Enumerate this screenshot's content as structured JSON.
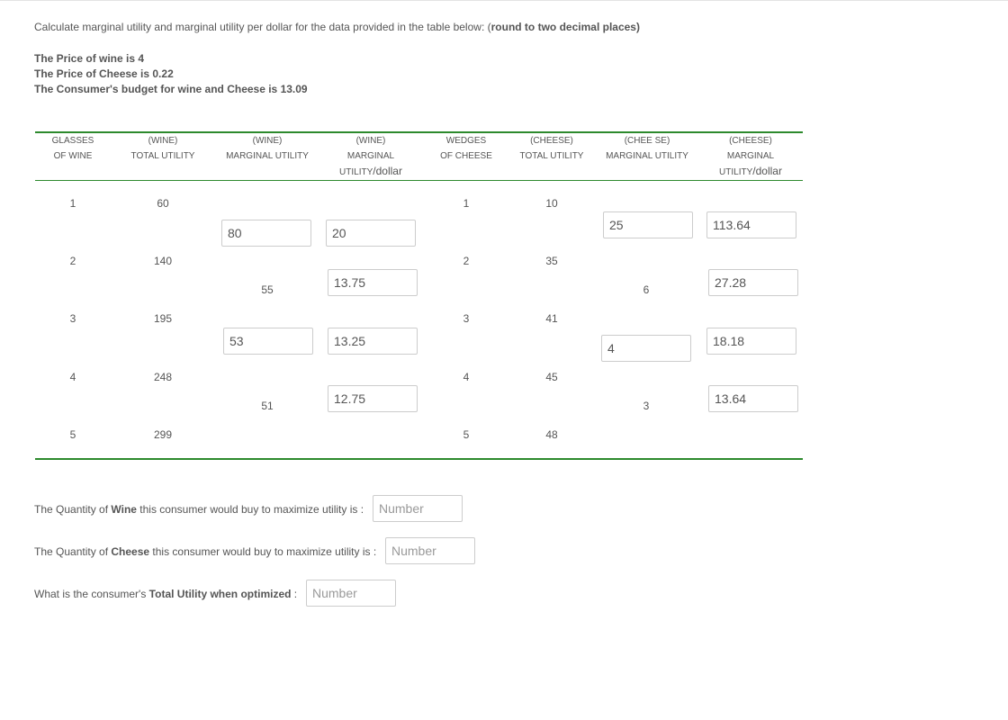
{
  "instructions": {
    "prefix": "Calculate marginal utility and marginal utility per dollar for the data provided in the table below: (",
    "bold": "round to two decimal places",
    "suffix": ")"
  },
  "given": {
    "wine_price": "The Price of wine is 4",
    "cheese_price": "The Price of Cheese is 0.22",
    "budget": "The Consumer's budget for wine and Cheese is 13.09"
  },
  "headers": {
    "glasses": [
      "GLASSES",
      "OF WINE"
    ],
    "wine_tu": [
      "(WINE)",
      "TOTAL UTILITY"
    ],
    "wine_mu": [
      "(WINE)",
      "MARGINAL UTILITY"
    ],
    "wine_mupd": [
      "(WINE)",
      "MARGINAL",
      "UTILITY",
      "/dollar"
    ],
    "wedges": [
      "WEDGES",
      "OF CHEESE"
    ],
    "cheese_tu": [
      "(CHEESE)",
      "TOTAL UTILITY"
    ],
    "cheese_mu": [
      "(CHEE SE)",
      "MARGINAL UTILITY"
    ],
    "cheese_mupd": [
      "(CHEESE)",
      "MARGINAL",
      "UTILITY",
      "/dollar"
    ]
  },
  "table": {
    "glasses": [
      "1",
      "2",
      "3",
      "4",
      "5"
    ],
    "wine_total_utility": [
      "60",
      "140",
      "195",
      "248",
      "299"
    ],
    "wedges": [
      "1",
      "2",
      "3",
      "4",
      "5"
    ],
    "cheese_total_utility": [
      "10",
      "35",
      "41",
      "45",
      "48"
    ],
    "wine_marginal_utility": [
      "80",
      "55",
      "53",
      "51"
    ],
    "wine_mu_per_dollar": [
      "20",
      "13.75",
      "13.25",
      "12.75"
    ],
    "cheese_marginal_utility": [
      "25",
      "6",
      "4",
      "3"
    ],
    "cheese_mu_per_dollar": [
      "113.64",
      "27.28",
      "18.18",
      "13.64"
    ]
  },
  "questions": {
    "wine": {
      "pre": "The Quantity of ",
      "bold": "Wine",
      "post": " this consumer would buy to maximize utility is :",
      "placeholder": "Number"
    },
    "cheese": {
      "pre": "The Quantity of ",
      "bold": "Cheese",
      "post": " this consumer would buy to maximize utility is :",
      "placeholder": "Number"
    },
    "total": {
      "pre": "What is the consumer's ",
      "bold": "Total Utility when optimized",
      "post": " :",
      "placeholder": "Number"
    }
  }
}
